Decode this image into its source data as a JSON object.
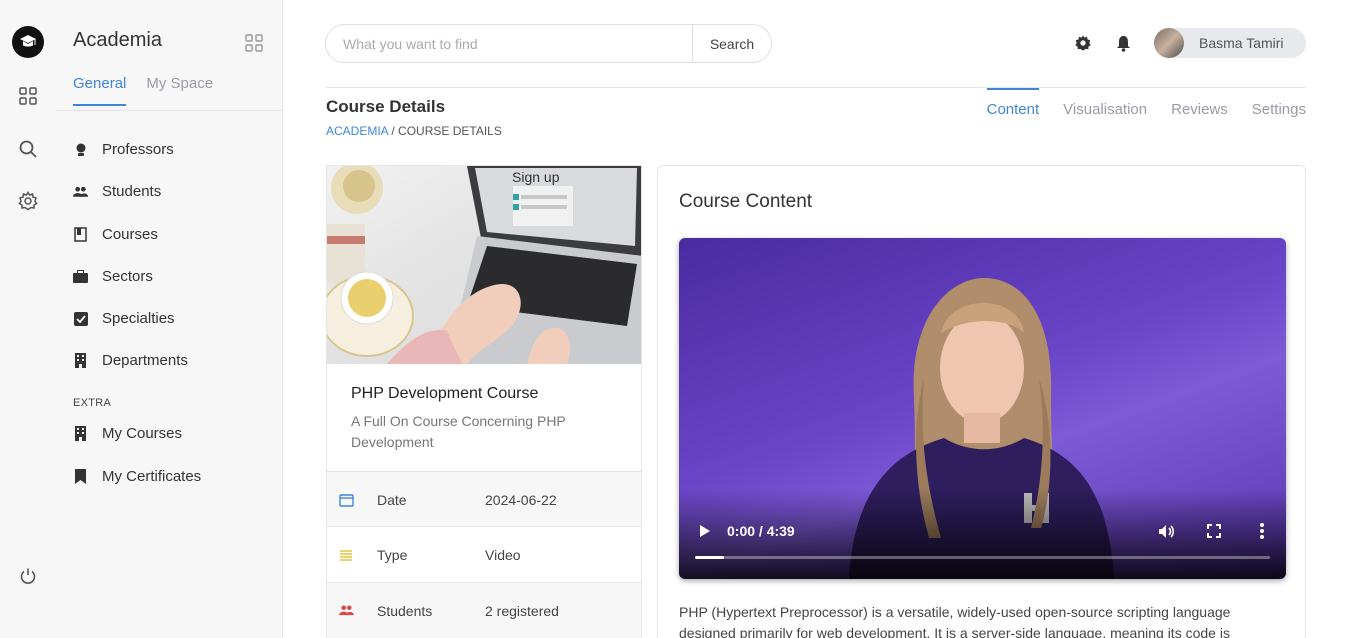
{
  "app": {
    "title": "Academia"
  },
  "sidebar": {
    "tabs": [
      {
        "label": "General"
      },
      {
        "label": "My Space"
      }
    ],
    "items": [
      {
        "label": "Professors",
        "icon": "professor-icon"
      },
      {
        "label": "Students",
        "icon": "students-icon"
      },
      {
        "label": "Courses",
        "icon": "courses-icon"
      },
      {
        "label": "Sectors",
        "icon": "sectors-icon"
      },
      {
        "label": "Specialties",
        "icon": "specialties-icon"
      },
      {
        "label": "Departments",
        "icon": "departments-icon"
      }
    ],
    "extra_label": "EXTRA",
    "extra_items": [
      {
        "label": "My Courses",
        "icon": "building-icon"
      },
      {
        "label": "My Certificates",
        "icon": "bookmark-icon"
      }
    ]
  },
  "search": {
    "placeholder": "What you want to find",
    "button_label": "Search"
  },
  "user": {
    "name": "Basma Tamiri"
  },
  "page": {
    "title": "Course Details",
    "breadcrumb_root": "ACADEMIA",
    "breadcrumb_sep": " / ",
    "breadcrumb_current": "COURSE DETAILS",
    "tabs": [
      {
        "label": "Content"
      },
      {
        "label": "Visualisation"
      },
      {
        "label": "Reviews"
      },
      {
        "label": "Settings"
      }
    ]
  },
  "course": {
    "title": "PHP Development Course",
    "subtitle": "A Full On Course Concerning PHP Development",
    "image_text": "Sign up",
    "details": [
      {
        "label": "Date",
        "value": "2024-06-22",
        "icon": "calendar-icon",
        "color": "#3f86d8"
      },
      {
        "label": "Type",
        "value": "Video",
        "icon": "list-icon",
        "color": "#e0c02a"
      },
      {
        "label": "Students",
        "value": "2 registered",
        "icon": "students-icon",
        "color": "#d84a4a"
      }
    ]
  },
  "content": {
    "title": "Course Content",
    "video": {
      "time": "0:00 / 4:39",
      "progress": 0.05
    },
    "description": "PHP (Hypertext Preprocessor) is a versatile, widely-used open-source scripting language designed primarily for web development. It is a server-side language, meaning its code is"
  },
  "colors": {
    "accent": "#3f86d8"
  }
}
